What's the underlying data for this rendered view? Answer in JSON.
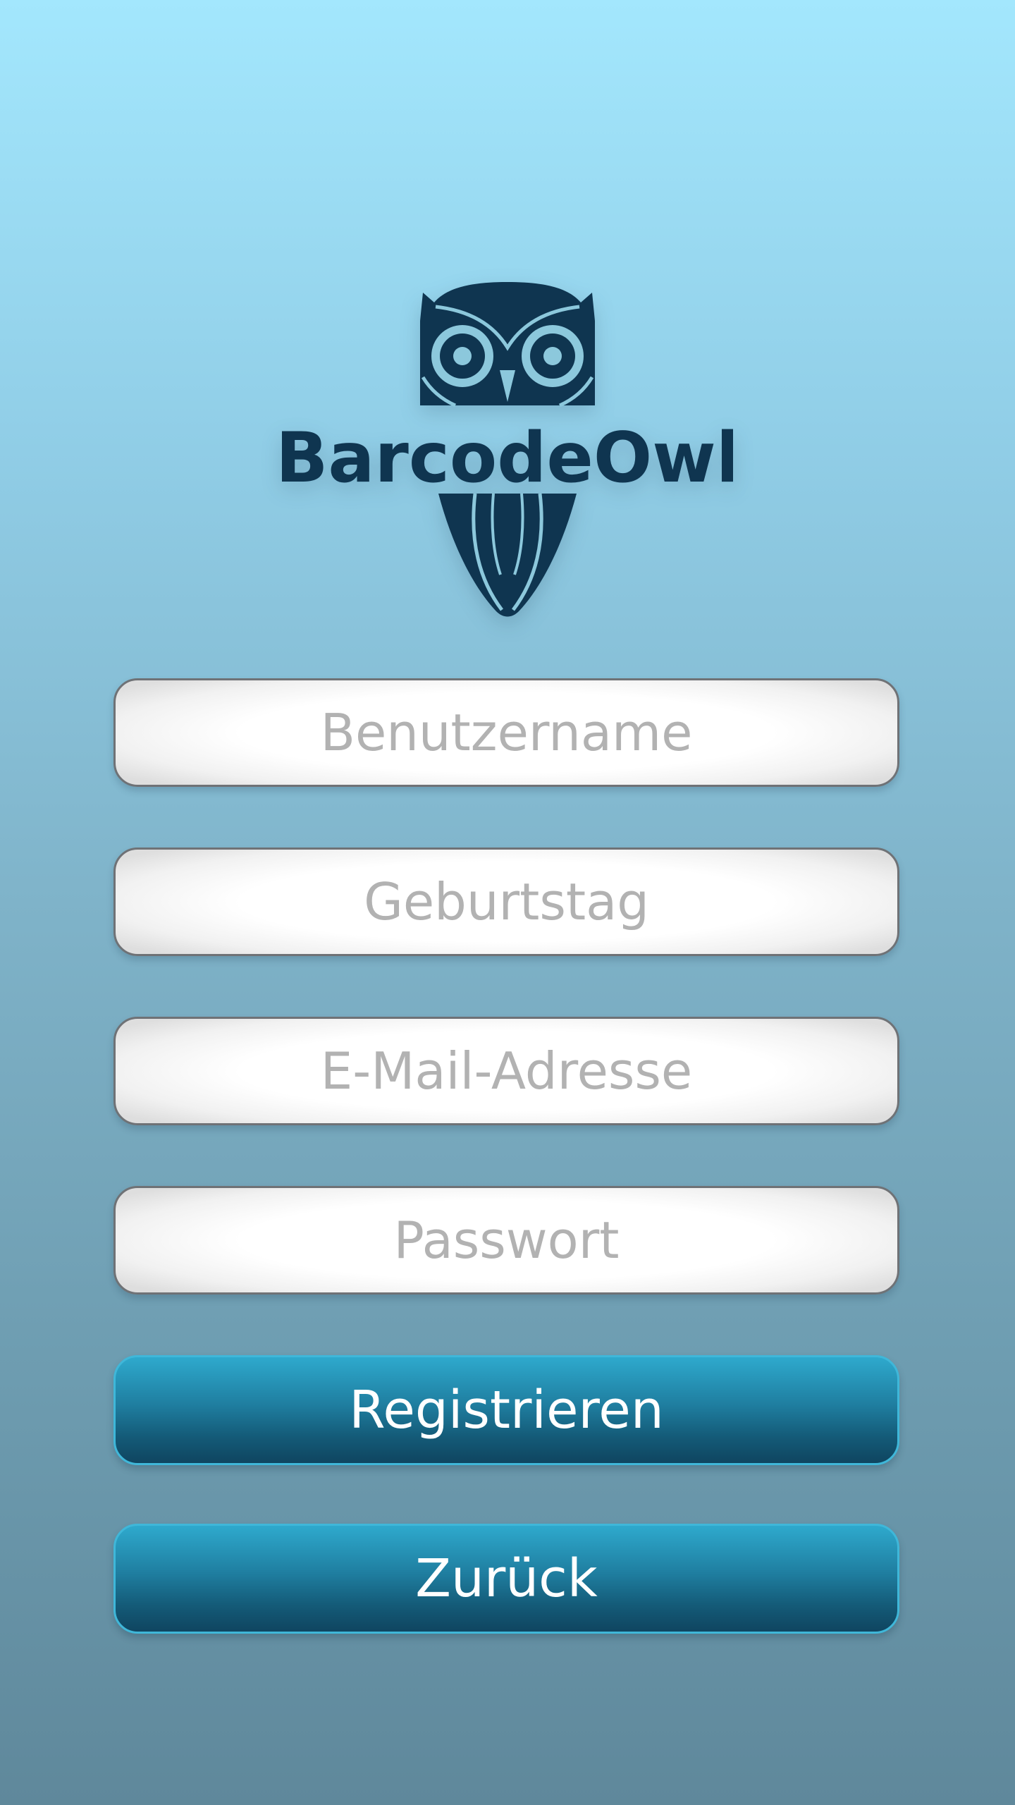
{
  "app": {
    "logo_text": "BarcodeOwl",
    "logo_color": "#0f3550"
  },
  "form": {
    "username_placeholder": "Benutzername",
    "username_value": "",
    "birthday_placeholder": "Geburtstag",
    "birthday_value": "",
    "email_placeholder": "E-Mail-Adresse",
    "email_value": "",
    "password_placeholder": "Passwort",
    "password_value": ""
  },
  "actions": {
    "register_label": "Registrieren",
    "back_label": "Zurück"
  },
  "colors": {
    "background_top": "#a3e7fd",
    "background_bottom": "#5f889b",
    "button_top": "#2ea9cd",
    "button_bottom": "#0f4560",
    "placeholder": "#b2b2b2"
  },
  "icons": {
    "logo": "owl-logo-icon"
  }
}
